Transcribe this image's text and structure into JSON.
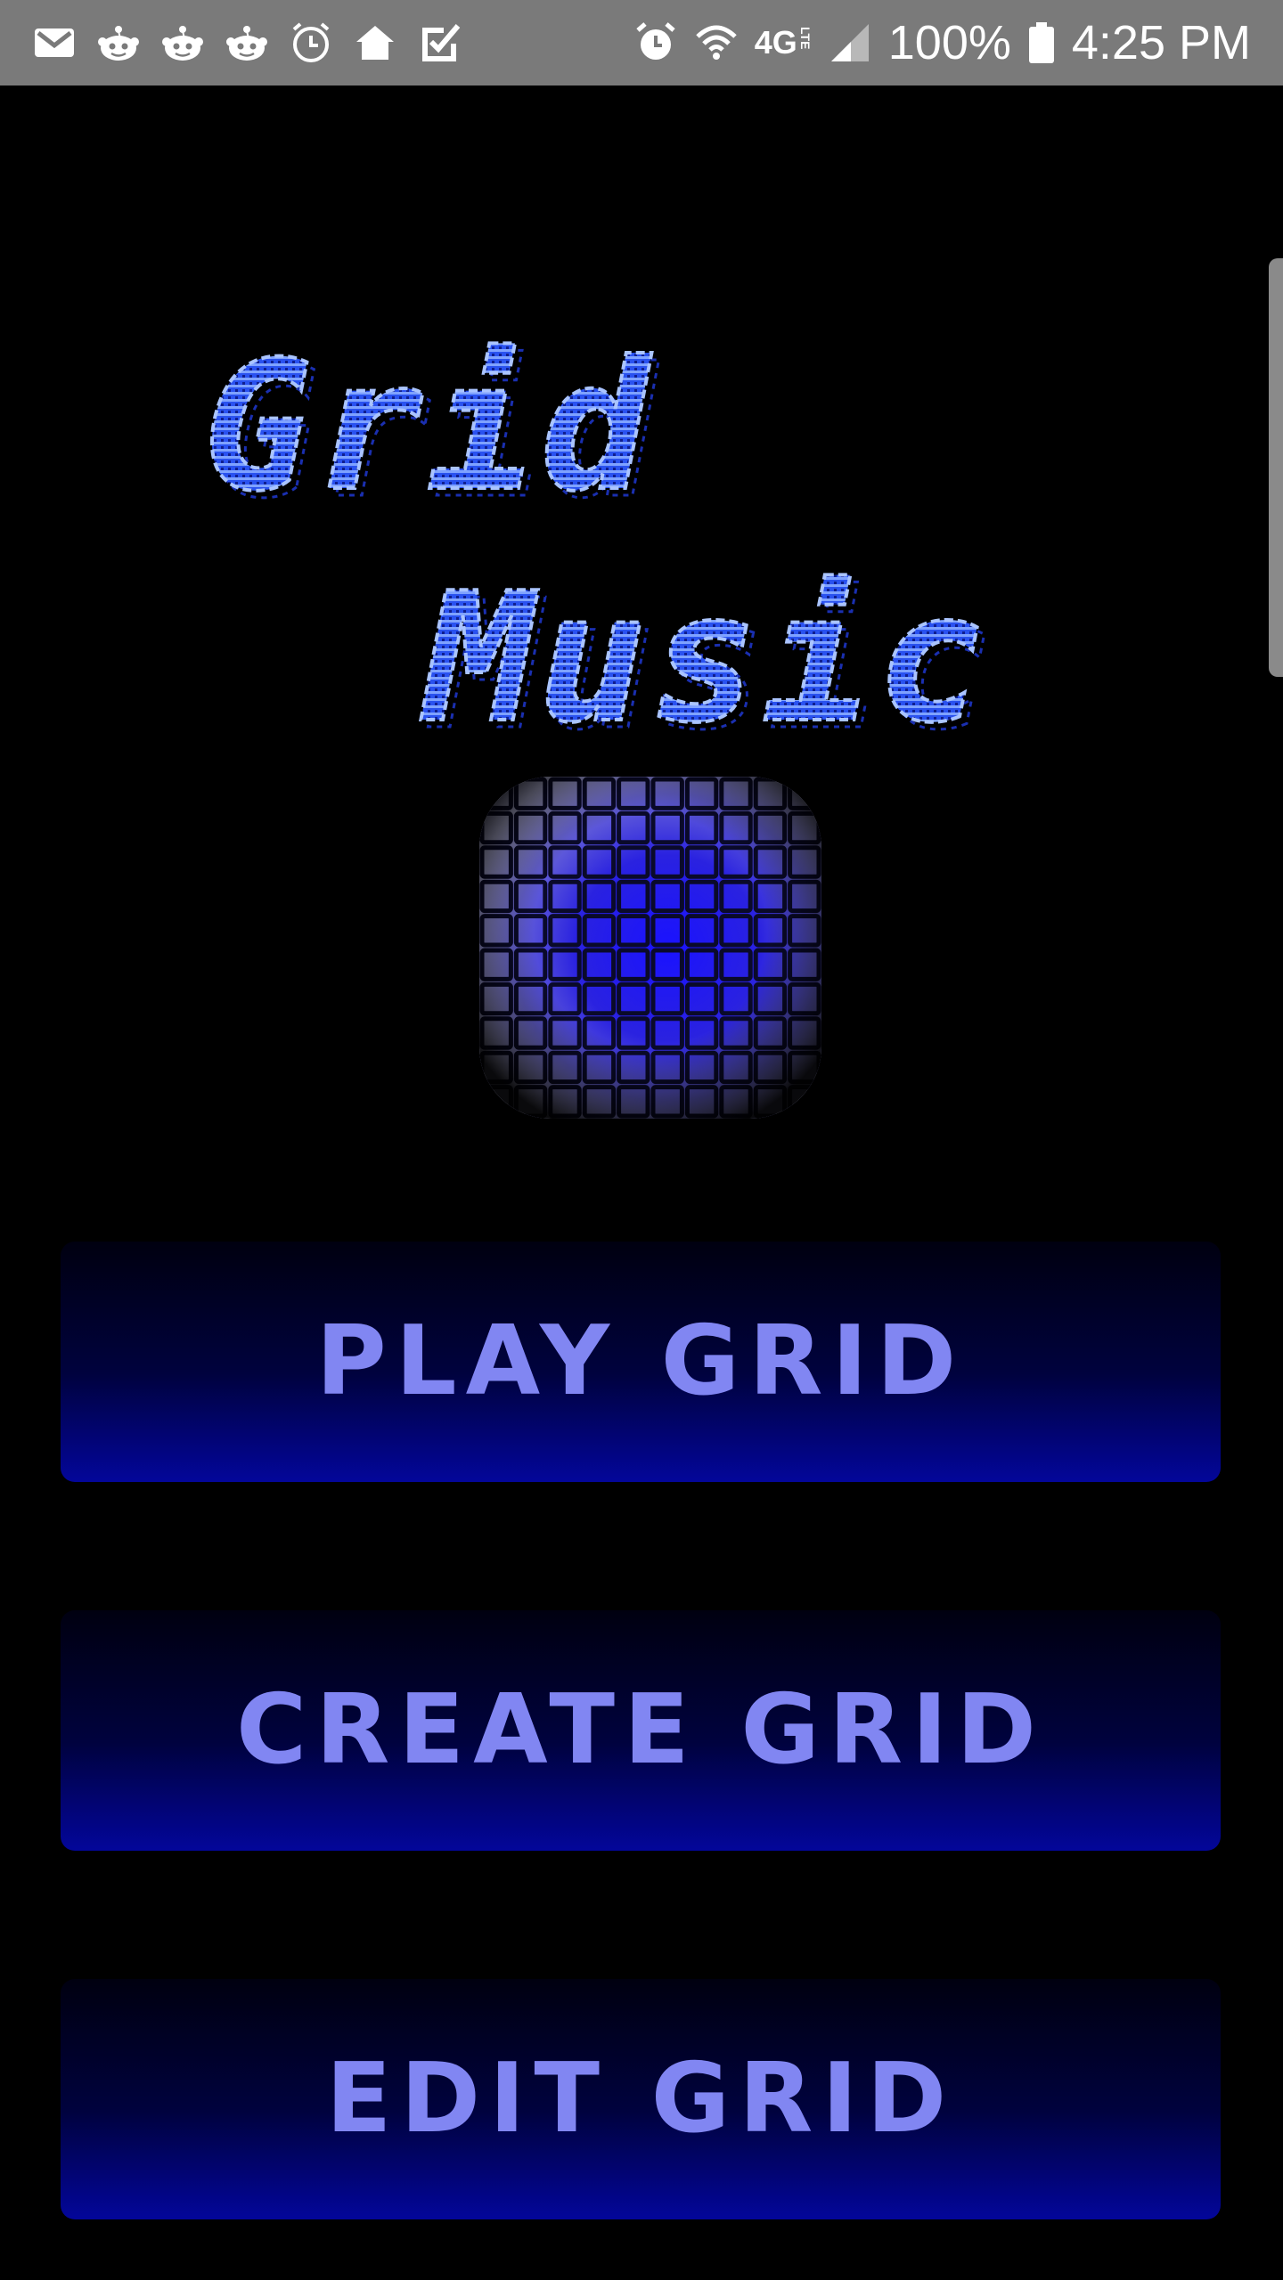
{
  "status_bar": {
    "left_icons": [
      "gmail-icon",
      "reddit-icon",
      "reddit-icon",
      "reddit-icon",
      "alarm-clock-icon",
      "home-icon",
      "task-check-icon"
    ],
    "right_icons": [
      "alarm-icon",
      "wifi-icon",
      "network-4g-lte-icon",
      "signal-icon",
      "battery-icon"
    ],
    "network_label": "4G",
    "network_sub_label": "LTE",
    "battery_percent": "100%",
    "time": "4:25 PM"
  },
  "title": {
    "line1": "Grid",
    "line2": "Music"
  },
  "logo": {
    "icon": "grid-logo-icon",
    "accent_color": "#1a12ff"
  },
  "menu": {
    "play_label": "PLAY GRID",
    "create_label": "CREATE GRID",
    "edit_label": "EDIT GRID"
  },
  "colors": {
    "background": "#000000",
    "status_bar": "#7a7a7a",
    "button_text": "#8186f2",
    "button_bottom": "#03069a",
    "title_fill": "#2f5cff"
  }
}
